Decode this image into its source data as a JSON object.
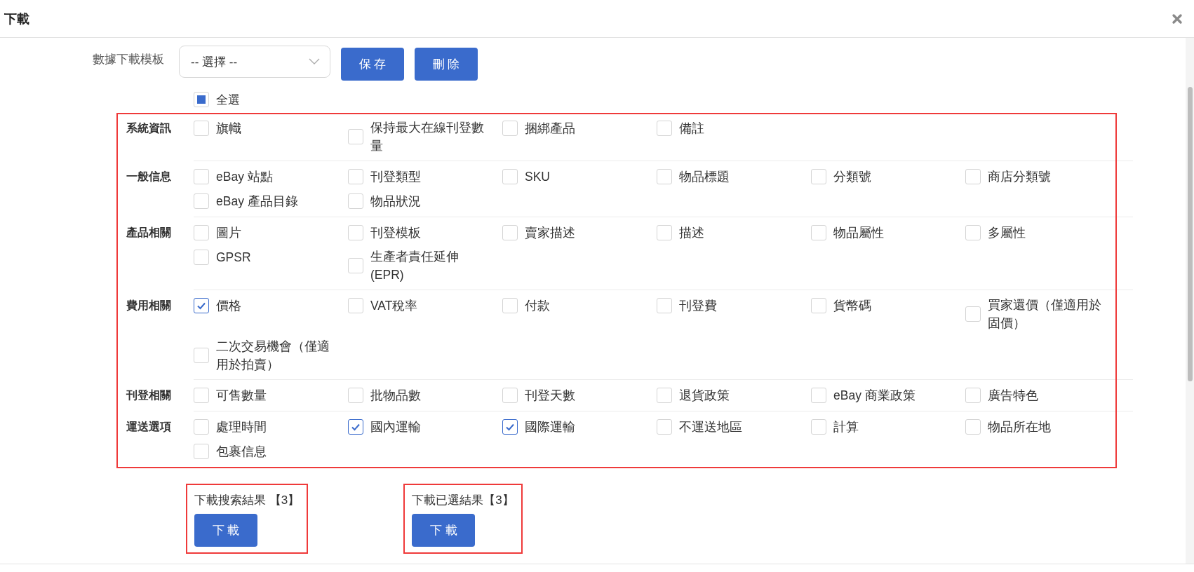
{
  "dialog": {
    "title": "下載"
  },
  "template": {
    "label": "數據下載模板",
    "placeholder": "-- 選擇 --",
    "buttons": [
      "保 存",
      "刪 除"
    ]
  },
  "select_all": {
    "label": "全選",
    "checked": false,
    "indeterminate": true
  },
  "field_groups": {
    "highlighted": true,
    "groups": [
      {
        "label": "系統資訊",
        "items": [
          {
            "label": "旗幟",
            "checked": false
          },
          {
            "label": "保持最大在線刊登數量",
            "checked": false
          },
          {
            "label": "捆綁產品",
            "checked": false
          },
          {
            "label": "備註",
            "checked": false
          }
        ]
      },
      {
        "label": "一般信息",
        "items": [
          {
            "label": "eBay 站點",
            "checked": false
          },
          {
            "label": "刊登類型",
            "checked": false
          },
          {
            "label": "SKU",
            "checked": false
          },
          {
            "label": "物品標題",
            "checked": false
          },
          {
            "label": "分類號",
            "checked": false
          },
          {
            "label": "商店分類號",
            "checked": false
          },
          {
            "label": "eBay 產品目錄",
            "checked": false
          },
          {
            "label": "物品狀況",
            "checked": false
          }
        ]
      },
      {
        "label": "產品相關",
        "items": [
          {
            "label": "圖片",
            "checked": false
          },
          {
            "label": "刊登模板",
            "checked": false
          },
          {
            "label": "賣家描述",
            "checked": false
          },
          {
            "label": "描述",
            "checked": false
          },
          {
            "label": "物品屬性",
            "checked": false
          },
          {
            "label": "多屬性",
            "checked": false
          },
          {
            "label": "GPSR",
            "checked": false
          },
          {
            "label": "生產者責任延伸 (EPR)",
            "checked": false
          }
        ]
      },
      {
        "label": "費用相關",
        "items": [
          {
            "label": "價格",
            "checked": true
          },
          {
            "label": "VAT稅率",
            "checked": false
          },
          {
            "label": "付款",
            "checked": false
          },
          {
            "label": "刊登費",
            "checked": false
          },
          {
            "label": "貨幣碼",
            "checked": false
          },
          {
            "label": "買家還價（僅適用於固價）",
            "checked": false
          },
          {
            "label": "二次交易機會（僅適用於拍賣）",
            "checked": false
          }
        ]
      },
      {
        "label": "刊登相關",
        "items": [
          {
            "label": "可售數量",
            "checked": false
          },
          {
            "label": "批物品數",
            "checked": false
          },
          {
            "label": "刊登天數",
            "checked": false
          },
          {
            "label": "退貨政策",
            "checked": false
          },
          {
            "label": "eBay 商業政策",
            "checked": false
          },
          {
            "label": "廣告特色",
            "checked": false
          }
        ]
      },
      {
        "label": "運送選項",
        "items": [
          {
            "label": "處理時間",
            "checked": false
          },
          {
            "label": "國內運輸",
            "checked": true
          },
          {
            "label": "國際運輸",
            "checked": true
          },
          {
            "label": "不運送地區",
            "checked": false
          },
          {
            "label": "計算",
            "checked": false
          },
          {
            "label": "物品所在地",
            "checked": false
          },
          {
            "label": "包裹信息",
            "checked": false
          }
        ]
      }
    ]
  },
  "downloads": [
    {
      "label": "下載搜索結果 【3】",
      "button": "下 載",
      "highlighted": true
    },
    {
      "label": "下載已選結果【3】",
      "button": "下 載",
      "highlighted": true
    }
  ]
}
